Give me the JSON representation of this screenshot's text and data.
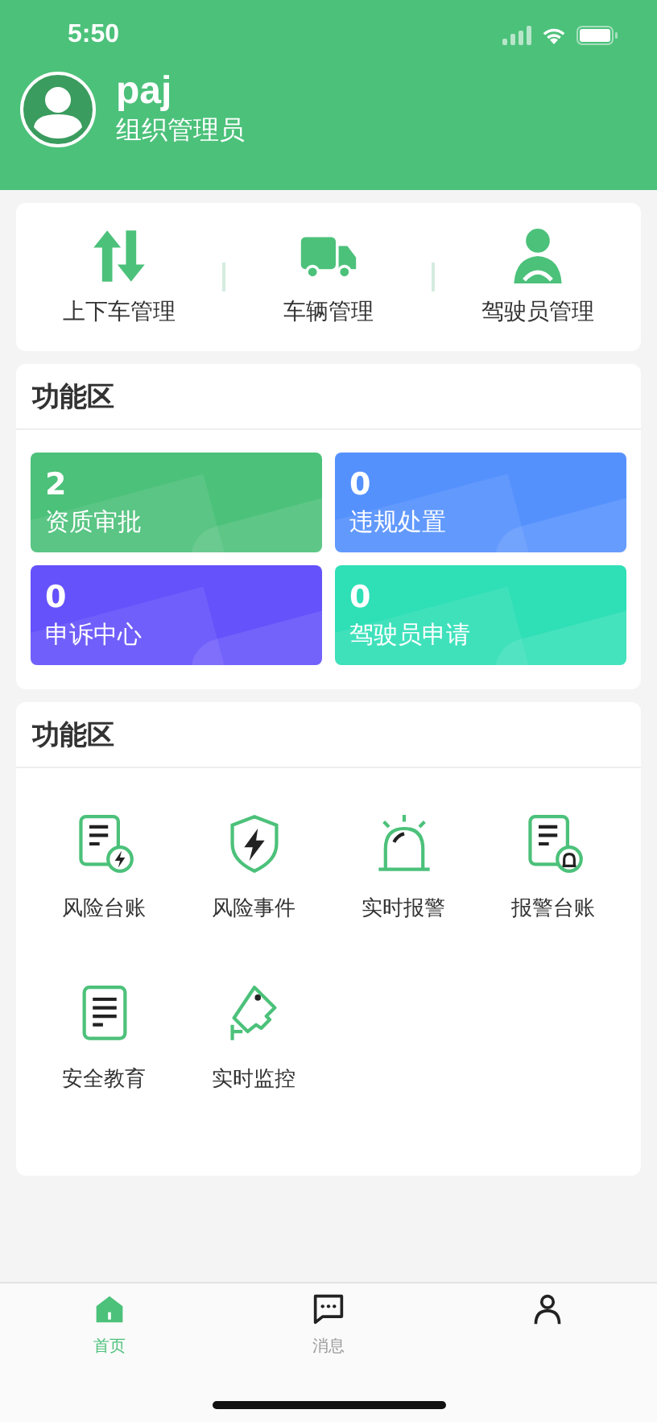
{
  "status_bar": {
    "time": "5:50"
  },
  "profile": {
    "name": "paj",
    "role": "组织管理员"
  },
  "quick_actions": [
    {
      "kind": "updown",
      "label": "上下车管理"
    },
    {
      "kind": "truck",
      "label": "车辆管理"
    },
    {
      "kind": "driver",
      "label": "驾驶员管理"
    }
  ],
  "stats_section": {
    "title": "功能区",
    "tiles": [
      {
        "count": "2",
        "label": "资质审批",
        "color": "#4cc17a"
      },
      {
        "count": "0",
        "label": "违规处置",
        "color": "#5591fd"
      },
      {
        "count": "0",
        "label": "申诉中心",
        "color": "#6552fb"
      },
      {
        "count": "0",
        "label": "驾驶员申请",
        "color": "#2fdfb6"
      }
    ]
  },
  "functions_section": {
    "title": "功能区",
    "items": [
      {
        "kind": "risk-ledger",
        "label": "风险台账"
      },
      {
        "kind": "risk-event",
        "label": "风险事件"
      },
      {
        "kind": "alarm",
        "label": "实时报警"
      },
      {
        "kind": "alarm-ledger",
        "label": "报警台账"
      },
      {
        "kind": "education",
        "label": "安全教育"
      },
      {
        "kind": "monitor",
        "label": "实时监控"
      }
    ]
  },
  "tab_bar": [
    {
      "kind": "home",
      "label": "首页",
      "selected": true
    },
    {
      "kind": "message",
      "label": "消息",
      "selected": false
    },
    {
      "kind": "profile",
      "selected": false
    }
  ]
}
